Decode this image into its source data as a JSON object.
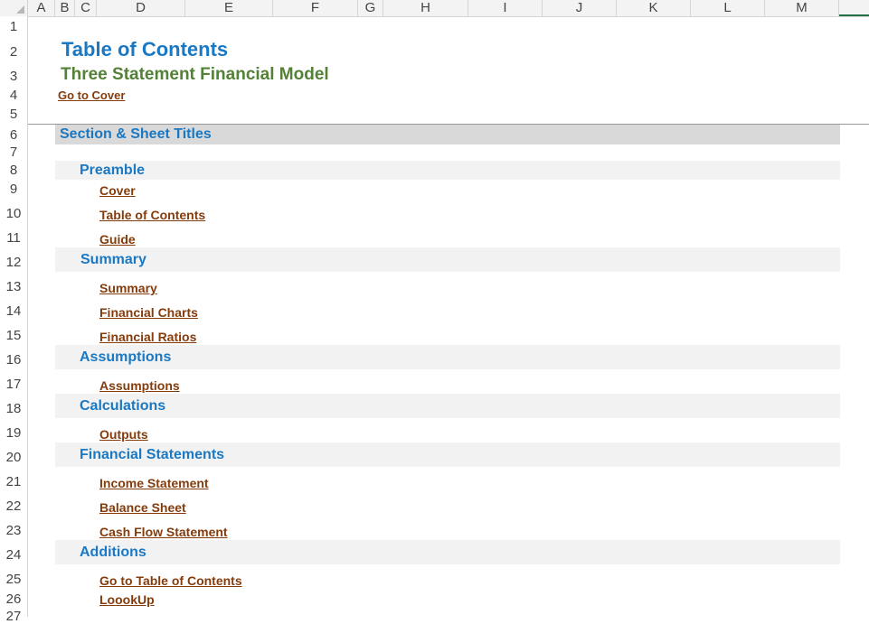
{
  "columns": [
    "A",
    "B",
    "C",
    "D",
    "E",
    "F",
    "G",
    "H",
    "I",
    "J",
    "K",
    "L",
    "M"
  ],
  "rows": [
    "1",
    "2",
    "3",
    "4",
    "5",
    "6",
    "7",
    "8",
    "9",
    "10",
    "11",
    "12",
    "13",
    "14",
    "15",
    "16",
    "17",
    "18",
    "19",
    "20",
    "21",
    "22",
    "23",
    "24",
    "25",
    "26",
    "27"
  ],
  "sheet": {
    "title": "Table of Contents",
    "subtitle": "Three Statement Financial Model",
    "go_to_cover": "Go to Cover",
    "section_header": "Section & Sheet Titles",
    "groups": [
      {
        "name": "Preamble",
        "links": [
          "Cover",
          "Table of Contents",
          "Guide"
        ]
      },
      {
        "name": "Summary",
        "links": [
          "Summary",
          "Financial Charts",
          "Financial Ratios"
        ]
      },
      {
        "name": "Assumptions",
        "links": [
          "Assumptions"
        ]
      },
      {
        "name": "Calculations",
        "links": [
          "Outputs"
        ]
      },
      {
        "name": "Financial Statements",
        "links": [
          "Income Statement",
          "Balance Sheet",
          "Cash Flow Statement"
        ]
      },
      {
        "name": "Additions",
        "links": [
          "Go to Table of Contents",
          "LoookUp"
        ]
      }
    ]
  },
  "colors": {
    "title_blue": "#1b78c2",
    "subtitle_green": "#538135",
    "link_brown": "#843c0c",
    "section_header_bg": "#d9d9d9",
    "group_band_bg": "#f2f2f2",
    "selection_green": "#217346"
  }
}
